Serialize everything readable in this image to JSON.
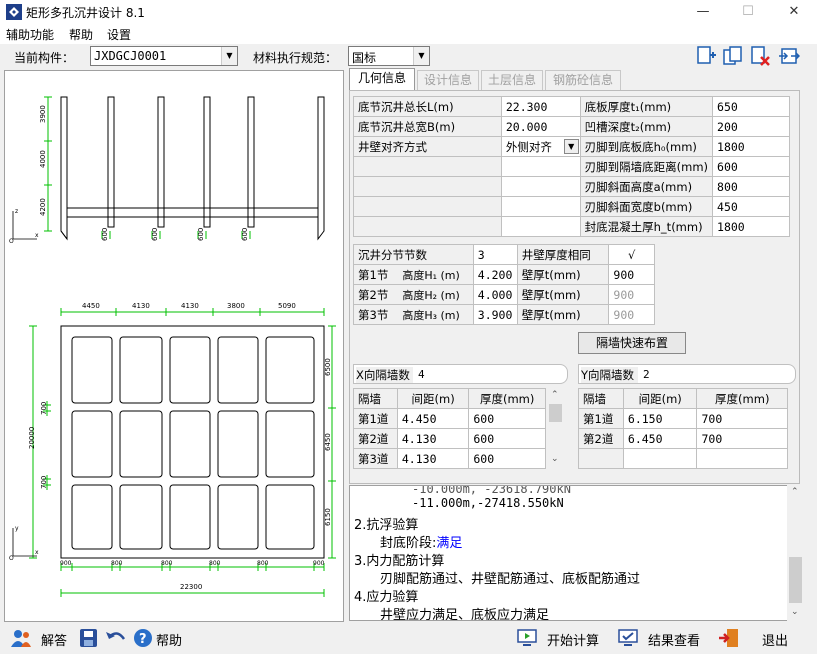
{
  "window": {
    "title": "矩形多孔沉井设计 8.1",
    "minimize": "—",
    "maximize": "☐",
    "close": "✕"
  },
  "menu": [
    "辅助功能",
    "帮助",
    "设置"
  ],
  "header": {
    "component_label": "当前构件：",
    "component_value": "JXDGCJ0001",
    "spec_label": "材料执行规范：",
    "spec_value": "国标"
  },
  "toolbar_icons": [
    "add-page-icon",
    "copy-page-icon",
    "delete-page-icon",
    "export-icon"
  ],
  "tabs": [
    "几何信息",
    "设计信息",
    "土层信息",
    "钢筋砼信息"
  ],
  "active_tab": 0,
  "geometry": {
    "rows": [
      {
        "l1": "底节沉井总长L(m)",
        "v1": "22.300",
        "l2": "底板厚度t₁(mm)",
        "v2": "650"
      },
      {
        "l1": "底节沉井总宽B(m)",
        "v1": "20.000",
        "l2": "凹槽深度t₂(mm)",
        "v2": "200"
      },
      {
        "l1": "井壁对齐方式",
        "v1": "外侧对齐",
        "l2": "刃脚到底板底h₀(mm)",
        "v2": "1800"
      },
      {
        "l1": "",
        "v1": "",
        "l2": "刃脚到隔墙底距离(mm)",
        "v2": "600"
      },
      {
        "l1": "",
        "v1": "",
        "l2": "刃脚斜面高度a(mm)",
        "v2": "800"
      },
      {
        "l1": "",
        "v1": "",
        "l2": "刃脚斜面宽度b(mm)",
        "v2": "450"
      },
      {
        "l1": "",
        "v1": "",
        "l2": "封底混凝土厚h_t(mm)",
        "v2": "1800"
      }
    ]
  },
  "sections": {
    "count_label": "沉井分节节数",
    "count_value": "3",
    "same_label": "井壁厚度相同",
    "same_value": "√",
    "rows": [
      {
        "name": "第1节",
        "hl": "高度H₁ (m)",
        "h": "4.200",
        "tl": "壁厚t(mm)",
        "t": "900"
      },
      {
        "name": "第2节",
        "hl": "高度H₂ (m)",
        "h": "4.000",
        "tl": "壁厚t(mm)",
        "t": "900"
      },
      {
        "name": "第3节",
        "hl": "高度H₃ (m)",
        "h": "3.900",
        "tl": "壁厚t(mm)",
        "t": "900"
      }
    ]
  },
  "quick_layout_button": "隔墙快速布置",
  "xwalls": {
    "count_label": "X向隔墙数",
    "count": "4",
    "headers": [
      "隔墙",
      "间距(m)",
      "厚度(mm)"
    ],
    "rows": [
      [
        "第1道",
        "4.450",
        "600"
      ],
      [
        "第2道",
        "4.130",
        "600"
      ],
      [
        "第3道",
        "4.130",
        "600"
      ]
    ]
  },
  "ywalls": {
    "count_label": "Y向隔墙数",
    "count": "2",
    "headers": [
      "隔墙",
      "间距(m)",
      "厚度(mm)"
    ],
    "rows": [
      [
        "第1道",
        "6.150",
        "700"
      ],
      [
        "第2道",
        "6.450",
        "700"
      ]
    ]
  },
  "log": [
    "-11.000m,-27418.550kN",
    "2.抗浮验算",
    "封底阶段:满足",
    "3.内力配筋计算",
    "刃脚配筋通过、井壁配筋通过、底板配筋通过",
    "4.应力验算",
    "井壁应力满足、底板应力满足"
  ],
  "log_highlight": "满足",
  "bottom": {
    "answer": "解答",
    "help": "帮助",
    "start": "开始计算",
    "results": "结果查看",
    "exit": "退出"
  },
  "drawing": {
    "elev_dims": [
      "3900",
      "4000",
      "4200"
    ],
    "elev_bottom": [
      "600",
      "600",
      "600",
      "600"
    ],
    "plan_top": [
      "4450",
      "4130",
      "4130",
      "3800",
      "5090"
    ],
    "plan_right": [
      "6500",
      "6450",
      "6150"
    ],
    "plan_left_total": "20000",
    "plan_left_inner": [
      "700",
      "700"
    ],
    "plan_bottom": [
      "900",
      "800",
      "800",
      "800",
      "800",
      "900"
    ],
    "plan_bottom_total": "22300"
  },
  "colors": {
    "dim_green": "#00c000",
    "highlight_blue": "#0000ff",
    "active_tab_text": "#000000"
  }
}
